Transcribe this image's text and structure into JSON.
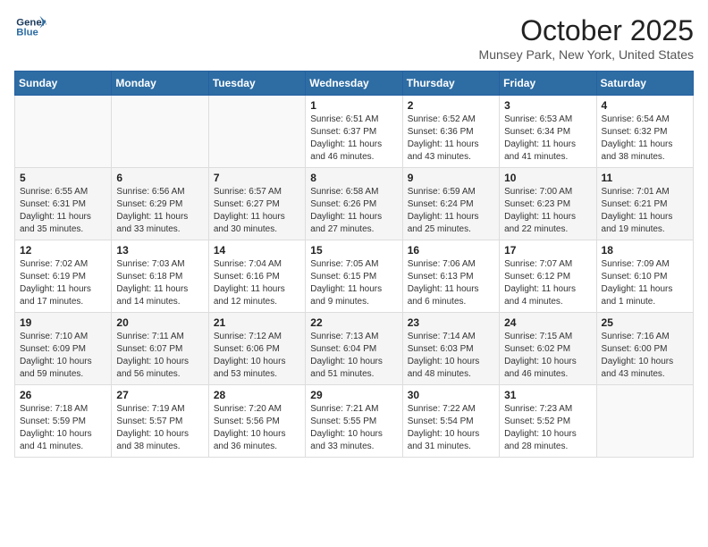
{
  "logo": {
    "line1": "General",
    "line2": "Blue"
  },
  "title": "October 2025",
  "location": "Munsey Park, New York, United States",
  "weekdays": [
    "Sunday",
    "Monday",
    "Tuesday",
    "Wednesday",
    "Thursday",
    "Friday",
    "Saturday"
  ],
  "weeks": [
    [
      {
        "day": "",
        "info": ""
      },
      {
        "day": "",
        "info": ""
      },
      {
        "day": "",
        "info": ""
      },
      {
        "day": "1",
        "info": "Sunrise: 6:51 AM\nSunset: 6:37 PM\nDaylight: 11 hours and 46 minutes."
      },
      {
        "day": "2",
        "info": "Sunrise: 6:52 AM\nSunset: 6:36 PM\nDaylight: 11 hours and 43 minutes."
      },
      {
        "day": "3",
        "info": "Sunrise: 6:53 AM\nSunset: 6:34 PM\nDaylight: 11 hours and 41 minutes."
      },
      {
        "day": "4",
        "info": "Sunrise: 6:54 AM\nSunset: 6:32 PM\nDaylight: 11 hours and 38 minutes."
      }
    ],
    [
      {
        "day": "5",
        "info": "Sunrise: 6:55 AM\nSunset: 6:31 PM\nDaylight: 11 hours and 35 minutes."
      },
      {
        "day": "6",
        "info": "Sunrise: 6:56 AM\nSunset: 6:29 PM\nDaylight: 11 hours and 33 minutes."
      },
      {
        "day": "7",
        "info": "Sunrise: 6:57 AM\nSunset: 6:27 PM\nDaylight: 11 hours and 30 minutes."
      },
      {
        "day": "8",
        "info": "Sunrise: 6:58 AM\nSunset: 6:26 PM\nDaylight: 11 hours and 27 minutes."
      },
      {
        "day": "9",
        "info": "Sunrise: 6:59 AM\nSunset: 6:24 PM\nDaylight: 11 hours and 25 minutes."
      },
      {
        "day": "10",
        "info": "Sunrise: 7:00 AM\nSunset: 6:23 PM\nDaylight: 11 hours and 22 minutes."
      },
      {
        "day": "11",
        "info": "Sunrise: 7:01 AM\nSunset: 6:21 PM\nDaylight: 11 hours and 19 minutes."
      }
    ],
    [
      {
        "day": "12",
        "info": "Sunrise: 7:02 AM\nSunset: 6:19 PM\nDaylight: 11 hours and 17 minutes."
      },
      {
        "day": "13",
        "info": "Sunrise: 7:03 AM\nSunset: 6:18 PM\nDaylight: 11 hours and 14 minutes."
      },
      {
        "day": "14",
        "info": "Sunrise: 7:04 AM\nSunset: 6:16 PM\nDaylight: 11 hours and 12 minutes."
      },
      {
        "day": "15",
        "info": "Sunrise: 7:05 AM\nSunset: 6:15 PM\nDaylight: 11 hours and 9 minutes."
      },
      {
        "day": "16",
        "info": "Sunrise: 7:06 AM\nSunset: 6:13 PM\nDaylight: 11 hours and 6 minutes."
      },
      {
        "day": "17",
        "info": "Sunrise: 7:07 AM\nSunset: 6:12 PM\nDaylight: 11 hours and 4 minutes."
      },
      {
        "day": "18",
        "info": "Sunrise: 7:09 AM\nSunset: 6:10 PM\nDaylight: 11 hours and 1 minute."
      }
    ],
    [
      {
        "day": "19",
        "info": "Sunrise: 7:10 AM\nSunset: 6:09 PM\nDaylight: 10 hours and 59 minutes."
      },
      {
        "day": "20",
        "info": "Sunrise: 7:11 AM\nSunset: 6:07 PM\nDaylight: 10 hours and 56 minutes."
      },
      {
        "day": "21",
        "info": "Sunrise: 7:12 AM\nSunset: 6:06 PM\nDaylight: 10 hours and 53 minutes."
      },
      {
        "day": "22",
        "info": "Sunrise: 7:13 AM\nSunset: 6:04 PM\nDaylight: 10 hours and 51 minutes."
      },
      {
        "day": "23",
        "info": "Sunrise: 7:14 AM\nSunset: 6:03 PM\nDaylight: 10 hours and 48 minutes."
      },
      {
        "day": "24",
        "info": "Sunrise: 7:15 AM\nSunset: 6:02 PM\nDaylight: 10 hours and 46 minutes."
      },
      {
        "day": "25",
        "info": "Sunrise: 7:16 AM\nSunset: 6:00 PM\nDaylight: 10 hours and 43 minutes."
      }
    ],
    [
      {
        "day": "26",
        "info": "Sunrise: 7:18 AM\nSunset: 5:59 PM\nDaylight: 10 hours and 41 minutes."
      },
      {
        "day": "27",
        "info": "Sunrise: 7:19 AM\nSunset: 5:57 PM\nDaylight: 10 hours and 38 minutes."
      },
      {
        "day": "28",
        "info": "Sunrise: 7:20 AM\nSunset: 5:56 PM\nDaylight: 10 hours and 36 minutes."
      },
      {
        "day": "29",
        "info": "Sunrise: 7:21 AM\nSunset: 5:55 PM\nDaylight: 10 hours and 33 minutes."
      },
      {
        "day": "30",
        "info": "Sunrise: 7:22 AM\nSunset: 5:54 PM\nDaylight: 10 hours and 31 minutes."
      },
      {
        "day": "31",
        "info": "Sunrise: 7:23 AM\nSunset: 5:52 PM\nDaylight: 10 hours and 28 minutes."
      },
      {
        "day": "",
        "info": ""
      }
    ]
  ]
}
